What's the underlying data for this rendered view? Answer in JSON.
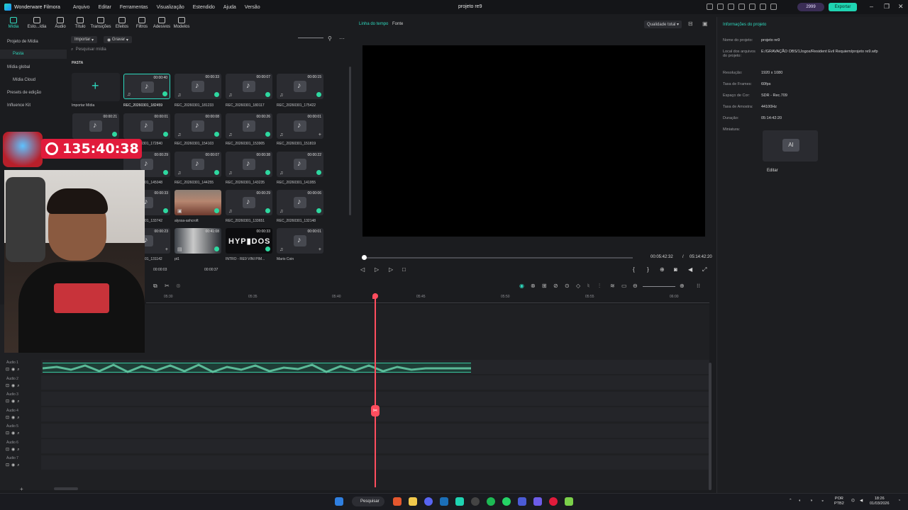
{
  "app": {
    "name": "Wonderware Filmora",
    "project_title": "projeto re9"
  },
  "menu": [
    "Arquivo",
    "Editar",
    "Ferramentas",
    "Visualização",
    "Estendido",
    "Ajuda",
    "Versão"
  ],
  "header": {
    "credits": "2999",
    "export_label": "Exportar"
  },
  "tools": [
    "Mídia",
    "Esto...ídia",
    "Áudio",
    "Título",
    "Transições",
    "Efeitos",
    "Filtros",
    "Adesivos",
    "Modelos"
  ],
  "leftnav": {
    "items": [
      "Projeto de Mídia",
      "Pasta",
      "Mídia global",
      "Mídia Cloud",
      "Presets de edição",
      "Influence Kit"
    ]
  },
  "media": {
    "import_label": "Importar",
    "record_label": "Gravar",
    "search_placeholder": "Pesquisar mídia",
    "folder_label": "PASTA",
    "import_media_label": "Importar Mídia",
    "items": [
      {
        "name": "REC_20260301_182459",
        "duration": "00:00:40"
      },
      {
        "name": "REC_20260301_181233",
        "duration": "00:00:33"
      },
      {
        "name": "REC_20260301_180117",
        "duration": "00:00:07"
      },
      {
        "name": "REC_20260301_175422",
        "duration": "00:00:15"
      },
      {
        "name": "REC_20260301_172840",
        "duration": "00:00:01"
      },
      {
        "name": "REC_20260301_154103",
        "duration": "00:00:08"
      },
      {
        "name": "REC_20260301_153905",
        "duration": "00:00:26"
      },
      {
        "name": "REC_20260301_151819",
        "duration": "00:00:01"
      },
      {
        "name": "REC_20260301_145048",
        "duration": "00:00:29"
      },
      {
        "name": "REC_20260301_144255",
        "duration": "00:00:07"
      },
      {
        "name": "REC_20260301_143235",
        "duration": "00:00:38"
      },
      {
        "name": "REC_20260301_141955",
        "duration": "00:00:22"
      },
      {
        "name": "REC_20260301_133742",
        "duration": "00:00:33"
      },
      {
        "name": "alyssa-ashcroft",
        "duration": ""
      },
      {
        "name": "REC_20260301_133651",
        "duration": "00:00:29"
      },
      {
        "name": "REC_20260301_132148",
        "duration": "00:00:06"
      },
      {
        "name": "REC_20260301_131142",
        "duration": "00:00:23"
      },
      {
        "name": "pt1",
        "duration": "00:41:08"
      },
      {
        "name": "INTRO - RE9 VINI PIM...",
        "duration": "00:00:33"
      },
      {
        "name": "Mario Coin",
        "duration": "00:00:01"
      }
    ],
    "bottom_durations": [
      "00:00:03",
      "00:00:37"
    ],
    "side_durations": [
      "00:00:21"
    ]
  },
  "preview": {
    "tab_timeline": "Linha do tempo",
    "tab_source": "Fonte",
    "quality": "Qualidade total",
    "current_time": "00:05:42:32",
    "separator": "/",
    "total_time": "05:14:42:20"
  },
  "info": {
    "title": "Informações do projeto",
    "rows": [
      {
        "label": "Nome do projeto:",
        "value": "projeto re9"
      },
      {
        "label": "Local dos arquivos do projeto:",
        "value": "E:/GRAVAÇÃO OBS/1Jogos/Resident Evil Requiem/projeto re9.wfp"
      },
      {
        "label": "Resolução:",
        "value": "1920 x 1080"
      },
      {
        "label": "Taxa de Frames:",
        "value": "60fps"
      },
      {
        "label": "Espaço de Cor:",
        "value": "SDR - Rec.709"
      },
      {
        "label": "Taxa de Amostra:",
        "value": "44100Hz"
      },
      {
        "label": "Duração:",
        "value": "05:14:42:20"
      },
      {
        "label": "Miniatura:",
        "value": ""
      }
    ],
    "edit_label": "Editar"
  },
  "timeline": {
    "ticks": [
      "05:30",
      "05:35",
      "05:40",
      "05:45",
      "05:50",
      "05:55",
      "06:00"
    ],
    "tracks": [
      "Áudio 1",
      "Áudio 2",
      "Áudio 3",
      "Áudio 4",
      "Áudio 5",
      "Áudio 6",
      "Áudio 7"
    ]
  },
  "overlay": {
    "timer": "135:40:38"
  },
  "taskbar": {
    "search_label": "Pesquisar",
    "lang": "POR",
    "layout": "PTB2",
    "time": "18:26",
    "date": "01/03/2026"
  }
}
